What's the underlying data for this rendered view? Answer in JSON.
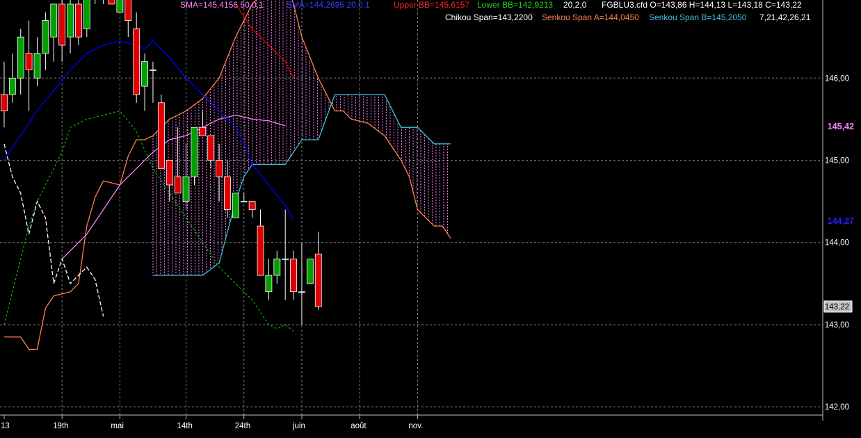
{
  "chart_data": {
    "type": "candlestick",
    "symbol_line": "FGBLU3.cfd O=143,86 H=144,13 L=143,18 C=143,22",
    "legend": {
      "sma50": "SMA=145,4156  50,0,1",
      "sma20": "SMA=144,2695  20,0,1",
      "upper_bb": "Upper BB=145,6157",
      "lower_bb": "Lower BB=142,9213",
      "bb_params": "20,2,0",
      "chikou": "Chikou Span=143,2200",
      "senkou_a": "Senkou Span A=144,0450",
      "senkou_b": "Senkou Span B=145,2050",
      "ichimoku_params": "7,21,42,26,21"
    },
    "colors": {
      "background": "#000000",
      "grid": "#808080",
      "up": "#00a000",
      "down": "#e00000",
      "sma50": "#ff80ff",
      "sma20": "#0000ff",
      "senkou_a": "#ff8050",
      "senkou_b": "#40c0e0",
      "chikou": "#ffffff",
      "lower_bb": "#00b000",
      "upper_bb": "#e00000",
      "cloud_hatch": "#ff80ff"
    },
    "y_axis": {
      "ticks": [
        142,
        143,
        144,
        145,
        146
      ],
      "tick_labels": [
        "142,00",
        "143,00",
        "144,00",
        "145,00",
        "146,00"
      ],
      "range": [
        141.9,
        146.95
      ],
      "value_badges": [
        {
          "text": "145,42",
          "value": 145.42,
          "color": "#ff80ff"
        },
        {
          "text": "144,27",
          "value": 144.27,
          "color": "#2020ff"
        },
        {
          "text": "143,22",
          "value": 143.22,
          "color": "#000000",
          "box": true
        }
      ]
    },
    "x_axis": {
      "labels": [
        {
          "text": "13",
          "idx": 0
        },
        {
          "text": "19th",
          "idx": 7
        },
        {
          "text": "mai",
          "idx": 14
        },
        {
          "text": "14th",
          "idx": 22
        },
        {
          "text": "24th",
          "idx": 29
        },
        {
          "text": "juin",
          "idx": 36
        },
        {
          "text": "août",
          "idx": 43
        },
        {
          "text": "nov.",
          "idx": 50
        }
      ],
      "range_idx": [
        -0.5,
        99
      ]
    },
    "candles": [
      {
        "o": 145.8,
        "h": 146.2,
        "l": 145.4,
        "c": 145.6
      },
      {
        "o": 145.8,
        "h": 146.3,
        "l": 145.7,
        "c": 146.0
      },
      {
        "o": 146.0,
        "h": 146.6,
        "l": 145.8,
        "c": 146.5
      },
      {
        "o": 146.3,
        "h": 146.7,
        "l": 145.6,
        "c": 146.1
      },
      {
        "o": 146.0,
        "h": 146.5,
        "l": 145.9,
        "c": 146.3
      },
      {
        "o": 146.3,
        "h": 146.8,
        "l": 146.1,
        "c": 146.7
      },
      {
        "o": 146.5,
        "h": 146.9,
        "l": 146.2,
        "c": 146.9
      },
      {
        "o": 146.9,
        "h": 147.0,
        "l": 146.2,
        "c": 146.4
      },
      {
        "o": 146.5,
        "h": 147.0,
        "l": 146.3,
        "c": 146.9
      },
      {
        "o": 146.9,
        "h": 147.2,
        "l": 146.4,
        "c": 146.5
      },
      {
        "o": 146.6,
        "h": 147.2,
        "l": 146.5,
        "c": 147.1
      },
      {
        "o": 147.2,
        "h": 147.4,
        "l": 146.9,
        "c": 147.0
      },
      {
        "o": 147.0,
        "h": 147.3,
        "l": 146.9,
        "c": 147.2
      },
      {
        "o": 147.2,
        "h": 147.4,
        "l": 146.9,
        "c": 146.9
      },
      {
        "o": 146.8,
        "h": 147.2,
        "l": 146.8,
        "c": 147.1
      },
      {
        "o": 147.1,
        "h": 147.3,
        "l": 146.5,
        "c": 146.7
      },
      {
        "o": 146.6,
        "h": 146.8,
        "l": 145.7,
        "c": 145.8
      },
      {
        "o": 145.9,
        "h": 146.3,
        "l": 145.6,
        "c": 146.2
      },
      {
        "o": 146.1,
        "h": 146.2,
        "l": 145.7,
        "c": 146.1
      },
      {
        "o": 145.7,
        "h": 145.8,
        "l": 144.9,
        "c": 144.9
      },
      {
        "o": 145.0,
        "h": 145.0,
        "l": 144.5,
        "c": 144.7
      },
      {
        "o": 144.8,
        "h": 145.4,
        "l": 144.6,
        "c": 144.6
      },
      {
        "o": 144.5,
        "h": 145.2,
        "l": 144.4,
        "c": 144.8
      },
      {
        "o": 144.8,
        "h": 145.4,
        "l": 144.7,
        "c": 145.4
      },
      {
        "o": 145.4,
        "h": 145.6,
        "l": 145.3,
        "c": 145.3
      },
      {
        "o": 145.3,
        "h": 145.3,
        "l": 144.9,
        "c": 145.0
      },
      {
        "o": 145.0,
        "h": 145.2,
        "l": 144.5,
        "c": 144.8
      },
      {
        "o": 144.8,
        "h": 145.0,
        "l": 144.3,
        "c": 144.4
      },
      {
        "o": 144.3,
        "h": 144.6,
        "l": 144.3,
        "c": 144.6
      },
      {
        "o": 144.5,
        "h": 144.6,
        "l": 144.5,
        "c": 144.5
      },
      {
        "o": 144.5,
        "h": 144.5,
        "l": 144.3,
        "c": 144.4
      },
      {
        "o": 144.2,
        "h": 144.4,
        "l": 143.6,
        "c": 143.6
      },
      {
        "o": 143.4,
        "h": 143.8,
        "l": 143.3,
        "c": 143.6
      },
      {
        "o": 143.6,
        "h": 143.9,
        "l": 143.5,
        "c": 143.8
      },
      {
        "o": 143.8,
        "h": 144.4,
        "l": 143.3,
        "c": 143.8
      },
      {
        "o": 143.8,
        "h": 143.9,
        "l": 143.3,
        "c": 143.4
      },
      {
        "o": 143.4,
        "h": 144.0,
        "l": 143.0,
        "c": 143.4
      },
      {
        "o": 143.5,
        "h": 143.8,
        "l": 143.5,
        "c": 143.8
      },
      {
        "o": 143.86,
        "h": 144.13,
        "l": 143.18,
        "c": 143.22
      }
    ],
    "sma50": [
      [
        7,
        143.8
      ],
      [
        10,
        144.1
      ],
      [
        12,
        144.4
      ],
      [
        14,
        144.7
      ],
      [
        16,
        144.9
      ],
      [
        18,
        145.1
      ],
      [
        20,
        145.25
      ],
      [
        22,
        145.3
      ],
      [
        24,
        145.4
      ],
      [
        26,
        145.5
      ],
      [
        28,
        145.55
      ],
      [
        30,
        145.5
      ],
      [
        32,
        145.48
      ],
      [
        34,
        145.42
      ]
    ],
    "sma20": [
      [
        0,
        145.0
      ],
      [
        2,
        145.3
      ],
      [
        4,
        145.6
      ],
      [
        6,
        145.85
      ],
      [
        8,
        146.1
      ],
      [
        10,
        146.3
      ],
      [
        12,
        146.4
      ],
      [
        14,
        146.45
      ],
      [
        16,
        146.4
      ],
      [
        17,
        146.35
      ],
      [
        18,
        146.45
      ],
      [
        20,
        146.25
      ],
      [
        22,
        146.0
      ],
      [
        24,
        145.8
      ],
      [
        26,
        145.6
      ],
      [
        28,
        145.4
      ],
      [
        29,
        145.2
      ],
      [
        30,
        144.95
      ],
      [
        32,
        144.7
      ],
      [
        34,
        144.45
      ],
      [
        35,
        144.27
      ]
    ],
    "senkou_a": [
      [
        0,
        142.85
      ],
      [
        2,
        142.85
      ],
      [
        3,
        142.7
      ],
      [
        4,
        142.7
      ],
      [
        5,
        143.2
      ],
      [
        6,
        143.35
      ],
      [
        8,
        143.4
      ],
      [
        9,
        143.5
      ],
      [
        10,
        144.2
      ],
      [
        11,
        144.55
      ],
      [
        12,
        144.75
      ],
      [
        14,
        144.7
      ],
      [
        15,
        145.05
      ],
      [
        16,
        145.25
      ],
      [
        17,
        145.25
      ],
      [
        18,
        145.3
      ],
      [
        20,
        145.5
      ],
      [
        22,
        145.6
      ],
      [
        24,
        145.75
      ],
      [
        26,
        146.0
      ],
      [
        28,
        146.5
      ],
      [
        30,
        146.9
      ],
      [
        32,
        147.1
      ],
      [
        33,
        147.2
      ],
      [
        34,
        147.2
      ],
      [
        35,
        146.9
      ],
      [
        36,
        146.5
      ],
      [
        38,
        146.0
      ],
      [
        40,
        145.6
      ],
      [
        41,
        145.6
      ],
      [
        42,
        145.5
      ],
      [
        44,
        145.45
      ],
      [
        46,
        145.3
      ],
      [
        48,
        145.0
      ],
      [
        49,
        144.8
      ],
      [
        50,
        144.4
      ],
      [
        52,
        144.2
      ],
      [
        53,
        144.2
      ],
      [
        54,
        144.05
      ]
    ],
    "senkou_b": [
      [
        18,
        143.6
      ],
      [
        20,
        143.6
      ],
      [
        22,
        143.6
      ],
      [
        24,
        143.6
      ],
      [
        26,
        143.75
      ],
      [
        28,
        144.5
      ],
      [
        29,
        144.8
      ],
      [
        30,
        144.95
      ],
      [
        32,
        144.95
      ],
      [
        34,
        144.95
      ],
      [
        36,
        145.25
      ],
      [
        38,
        145.25
      ],
      [
        40,
        145.8
      ],
      [
        41,
        145.8
      ],
      [
        44,
        145.8
      ],
      [
        46,
        145.8
      ],
      [
        48,
        145.4
      ],
      [
        50,
        145.4
      ],
      [
        52,
        145.2
      ],
      [
        54,
        145.2
      ]
    ],
    "chikou": [
      [
        0,
        145.2
      ],
      [
        1,
        144.8
      ],
      [
        2,
        144.6
      ],
      [
        3,
        144.1
      ],
      [
        4,
        144.5
      ],
      [
        5,
        144.3
      ],
      [
        6,
        143.5
      ],
      [
        7,
        143.8
      ],
      [
        8,
        143.5
      ],
      [
        9,
        143.6
      ],
      [
        10,
        143.7
      ],
      [
        11,
        143.55
      ],
      [
        12,
        143.1
      ]
    ],
    "lower_bb": [
      [
        0,
        143.0
      ],
      [
        1,
        143.4
      ],
      [
        2,
        143.8
      ],
      [
        3,
        144.2
      ],
      [
        4,
        144.5
      ],
      [
        5,
        144.7
      ],
      [
        6,
        144.9
      ],
      [
        7,
        145.1
      ],
      [
        8,
        145.4
      ],
      [
        10,
        145.5
      ],
      [
        12,
        145.55
      ],
      [
        14,
        145.6
      ],
      [
        16,
        145.35
      ],
      [
        18,
        144.9
      ],
      [
        20,
        144.6
      ],
      [
        22,
        144.3
      ],
      [
        24,
        144.0
      ],
      [
        26,
        143.7
      ],
      [
        28,
        143.5
      ],
      [
        30,
        143.3
      ],
      [
        32,
        143.0
      ],
      [
        33,
        142.95
      ],
      [
        34,
        143.0
      ],
      [
        35,
        142.92
      ]
    ],
    "upper_bb": [
      [
        28,
        146.9
      ],
      [
        30,
        146.6
      ],
      [
        32,
        146.4
      ],
      [
        34,
        146.2
      ],
      [
        35,
        146.0
      ]
    ]
  }
}
